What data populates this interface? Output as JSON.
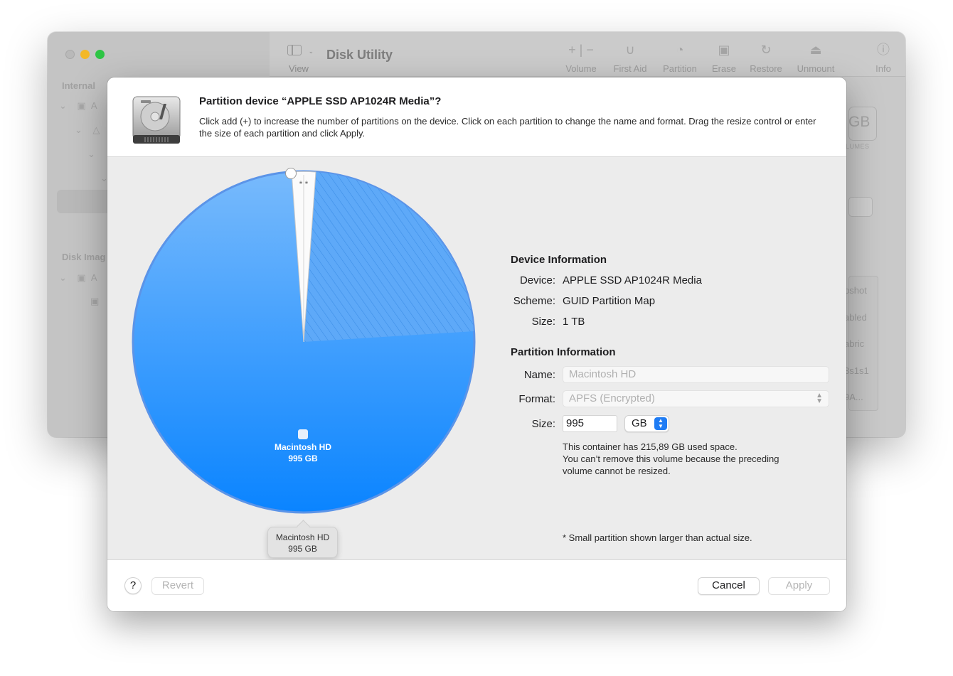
{
  "background_window": {
    "title": "Disk Utility",
    "view_label": "View",
    "toolbar": [
      {
        "label": "Volume",
        "icon": "plus-minus-icon"
      },
      {
        "label": "First Aid",
        "icon": "stethoscope-icon"
      },
      {
        "label": "Partition",
        "icon": "pie-chart-icon"
      },
      {
        "label": "Erase",
        "icon": "erase-icon"
      },
      {
        "label": "Restore",
        "icon": "restore-icon"
      },
      {
        "label": "Unmount",
        "icon": "eject-icon"
      },
      {
        "label": "Info",
        "icon": "info-icon"
      }
    ],
    "sidebar": {
      "internal_label": "Internal",
      "disk_images_label": "Disk Imag",
      "row_fragment": "A"
    },
    "detail_fragments": {
      "size_fragment": "GB",
      "volumes_fragment": "LUMES",
      "rows": [
        "pshot",
        "abled",
        "abric",
        "3s1s1",
        "9A..."
      ]
    }
  },
  "dialog": {
    "title": "Partition device “APPLE SSD AP1024R Media”?",
    "description": "Click add (+) to increase the number of partitions on the device. Click on each partition to change the name and format. Drag the resize control or enter the size of each partition and click Apply.",
    "pie": {
      "partition_name": "Macintosh HD",
      "partition_size": "995 GB",
      "small_marker": "* *",
      "tooltip_name": "Macintosh HD",
      "tooltip_size": "995 GB"
    },
    "device_info": {
      "heading": "Device Information",
      "device_label": "Device:",
      "device_value": "APPLE SSD AP1024R Media",
      "scheme_label": "Scheme:",
      "scheme_value": "GUID Partition Map",
      "size_label": "Size:",
      "size_value": "1 TB"
    },
    "partition_info": {
      "heading": "Partition Information",
      "name_label": "Name:",
      "name_placeholder": "Macintosh HD",
      "format_label": "Format:",
      "format_value": "APFS (Encrypted)",
      "size_label": "Size:",
      "size_value": "995",
      "unit_value": "GB",
      "note_line1": "This container has 215,89 GB used space.",
      "note_line2": "You can’t remove this volume because the preceding",
      "note_line3": "volume cannot be resized.",
      "footnote": "* Small partition shown larger than actual size."
    },
    "buttons": {
      "help": "?",
      "revert": "Revert",
      "cancel": "Cancel",
      "apply": "Apply"
    }
  },
  "colors": {
    "pie_blue_top": "#78bafc",
    "pie_blue_bottom": "#0a84ff",
    "pie_stroke": "#5b94e8",
    "stepper_blue": "#1f7cf4",
    "traffic_yellow": "#f3b828",
    "traffic_green": "#2ec545"
  }
}
